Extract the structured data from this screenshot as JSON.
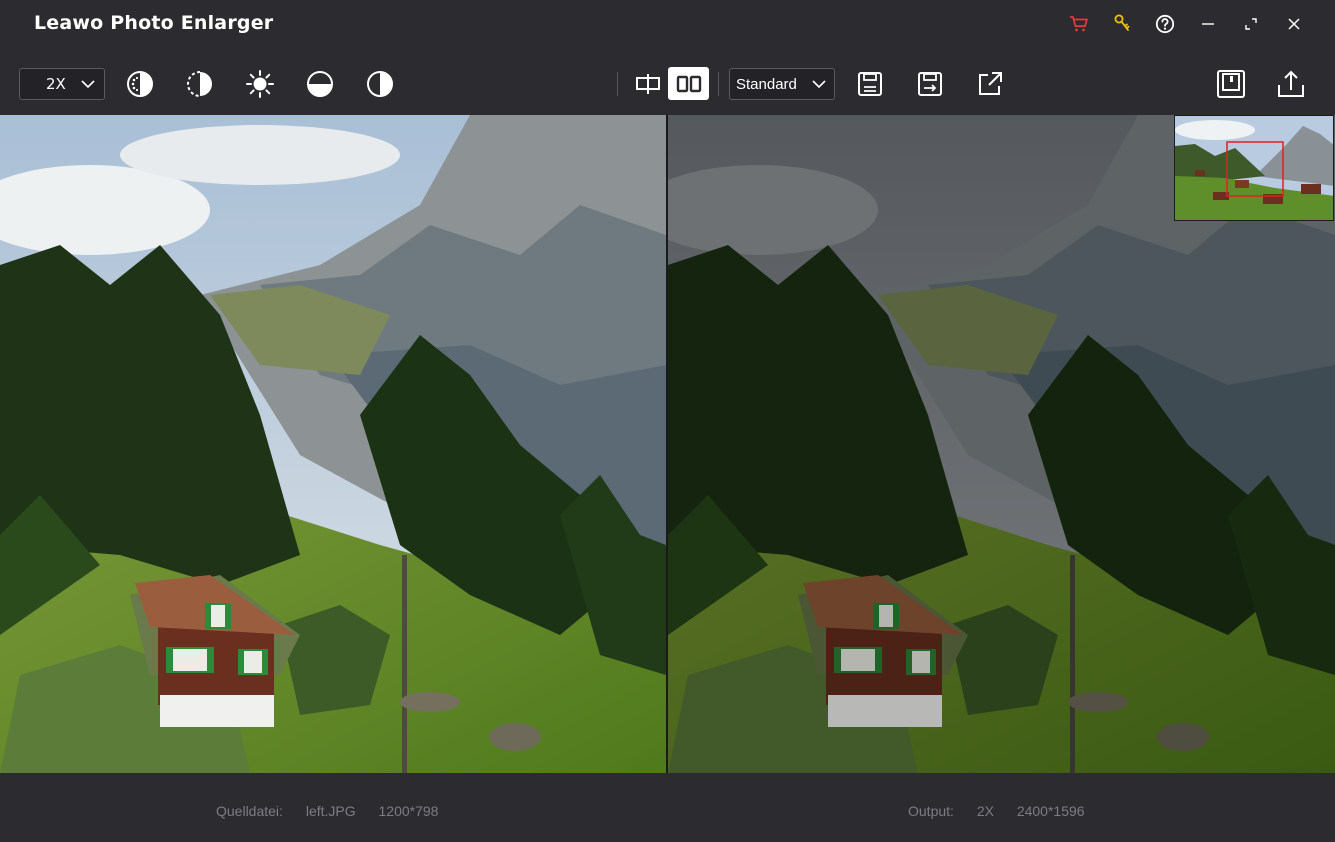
{
  "app": {
    "title": "Leawo Photo Enlarger"
  },
  "toolbar": {
    "scale_value": "2X",
    "mode_value": "Standard",
    "tools": [
      "saturation-icon",
      "contrast-icon",
      "brightness-icon",
      "exposure-icon",
      "sharpness-icon"
    ],
    "view_modes": [
      "split-center-icon",
      "side-by-side-icon"
    ],
    "actions": [
      "save-icon",
      "save-as-icon",
      "export-icon",
      "batch-save-icon",
      "share-icon"
    ]
  },
  "window_controls": [
    "cart-icon",
    "key-icon",
    "help-icon",
    "minimize-icon",
    "maximize-icon",
    "close-icon"
  ],
  "footer": {
    "source_label": "Quelldatei:",
    "source_file": "left.JPG",
    "source_size": "1200*798",
    "output_label": "Output:",
    "output_scale": "2X",
    "output_size": "2400*1596"
  },
  "colors": {
    "background": "#2b2b30",
    "cart": "#e23b3b",
    "key": "#f2c200",
    "text_muted": "#7c7c83",
    "thumb_marker": "#e02020"
  }
}
